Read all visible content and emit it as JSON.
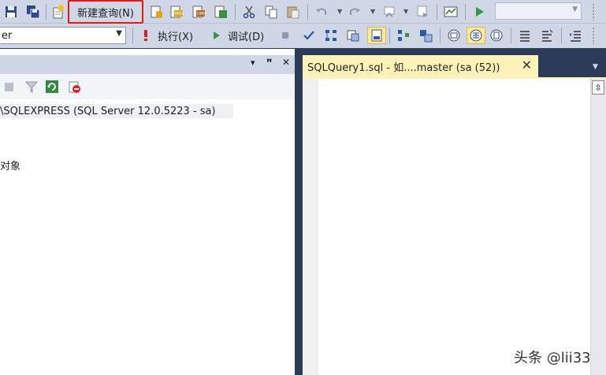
{
  "toolbar1": {
    "new_query_label": "新建查询(N)"
  },
  "toolbar2": {
    "database_value": "er",
    "execute_label": "执行(X)",
    "debug_label": "调试(D)"
  },
  "object_explorer": {
    "server_node": "\\SQLEXPRESS (SQL Server 12.0.5223 - sa)",
    "objects_label": "对象",
    "panel_glyphs": {
      "dropdown": "▾",
      "pin": "ꟸ",
      "close": "✕"
    }
  },
  "editor": {
    "tab_title": "SQLQuery1.sql - 如....master (sa (52))",
    "tab_close": "✕"
  },
  "watermark": "头条 @lii33",
  "icons": [
    "save-icon",
    "save-all-icon",
    "new-query-icon",
    "db-engine-query-icon",
    "mdx-query-icon",
    "dmx-query-icon",
    "xmla-query-icon",
    "cut-icon",
    "copy-icon",
    "paste-icon",
    "undo-icon",
    "redo-icon",
    "navigate-icon",
    "start-debug-icon",
    "execute-icon",
    "parse-icon",
    "display-plan-icon",
    "results-to-text-icon",
    "results-to-grid-icon",
    "filter-icon",
    "refresh-icon"
  ],
  "colors": {
    "highlight": "#e0191b",
    "active_tab": "#fff2b8",
    "chrome": "#cfd6e5",
    "dark": "#2b3c59"
  }
}
